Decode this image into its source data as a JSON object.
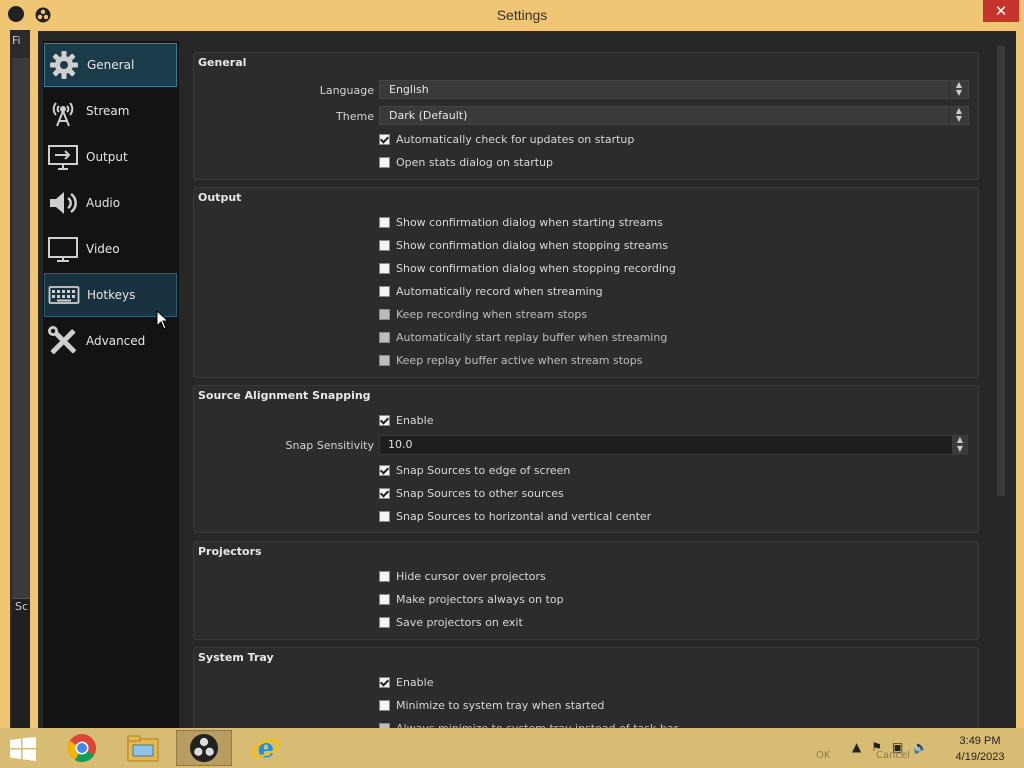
{
  "window": {
    "title": "Settings",
    "close_label": "✕"
  },
  "background": {
    "menu_hint": "Fi",
    "panel_hint": "Sc"
  },
  "sidebar": {
    "items": [
      {
        "label": "General",
        "icon": "gear-icon",
        "state": "selected"
      },
      {
        "label": "Stream",
        "icon": "broadcast-tower-icon",
        "state": "normal"
      },
      {
        "label": "Output",
        "icon": "output-monitor-icon",
        "state": "normal"
      },
      {
        "label": "Audio",
        "icon": "speaker-icon",
        "state": "normal"
      },
      {
        "label": "Video",
        "icon": "monitor-icon",
        "state": "normal"
      },
      {
        "label": "Hotkeys",
        "icon": "keyboard-icon",
        "state": "hover"
      },
      {
        "label": "Advanced",
        "icon": "tools-icon",
        "state": "normal"
      }
    ]
  },
  "general": {
    "title": "General",
    "language_label": "Language",
    "language_value": "English",
    "theme_label": "Theme",
    "theme_value": "Dark (Default)",
    "auto_update": {
      "label": "Automatically check for updates on startup",
      "checked": true
    },
    "stats_dialog": {
      "label": "Open stats dialog on startup",
      "checked": false
    }
  },
  "output": {
    "title": "Output",
    "options": [
      {
        "label": "Show confirmation dialog when starting streams",
        "checked": false,
        "enabled": true
      },
      {
        "label": "Show confirmation dialog when stopping streams",
        "checked": false,
        "enabled": true
      },
      {
        "label": "Show confirmation dialog when stopping recording",
        "checked": false,
        "enabled": true
      },
      {
        "label": "Automatically record when streaming",
        "checked": false,
        "enabled": true
      },
      {
        "label": "Keep recording when stream stops",
        "checked": false,
        "enabled": false
      },
      {
        "label": "Automatically start replay buffer when streaming",
        "checked": false,
        "enabled": false
      },
      {
        "label": "Keep replay buffer active when stream stops",
        "checked": false,
        "enabled": false
      }
    ]
  },
  "snapping": {
    "title": "Source Alignment Snapping",
    "enable": {
      "label": "Enable",
      "checked": true
    },
    "sensitivity_label": "Snap Sensitivity",
    "sensitivity_value": "10.0",
    "options": [
      {
        "label": "Snap Sources to edge of screen",
        "checked": true
      },
      {
        "label": "Snap Sources to other sources",
        "checked": true
      },
      {
        "label": "Snap Sources to horizontal and vertical center",
        "checked": false
      }
    ]
  },
  "projectors": {
    "title": "Projectors",
    "options": [
      {
        "label": "Hide cursor over projectors",
        "checked": false
      },
      {
        "label": "Make projectors always on top",
        "checked": false
      },
      {
        "label": "Save projectors on exit",
        "checked": false
      }
    ]
  },
  "system_tray": {
    "title": "System Tray",
    "options": [
      {
        "label": "Enable",
        "checked": true,
        "enabled": true
      },
      {
        "label": "Minimize to system tray when started",
        "checked": false,
        "enabled": true
      },
      {
        "label": "Always minimize to system tray instead of task bar",
        "checked": false,
        "enabled": false
      }
    ]
  },
  "dialog_buttons": {
    "ok": "OK",
    "cancel": "Cancel"
  },
  "taskbar": {
    "apps": [
      "chrome-icon",
      "file-explorer-icon",
      "obs-icon",
      "internet-explorer-icon"
    ],
    "active_app": "obs-icon",
    "time": "3:49 PM",
    "date": "4/19/2023"
  },
  "colors": {
    "title_bar": "#f0c674",
    "panel_bg": "#272727",
    "sidebar_bg": "#131313",
    "selected_bg": "#1a3b4a",
    "close_button": "#c7342c",
    "taskbar": "#d9bc74"
  }
}
